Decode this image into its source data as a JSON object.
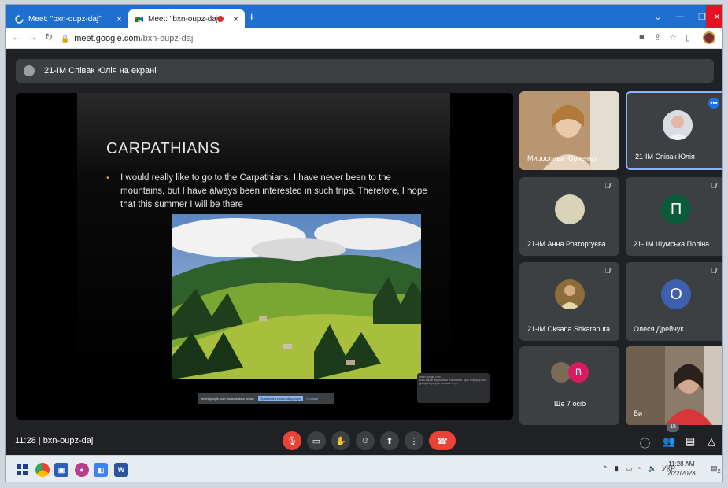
{
  "browser": {
    "tabs": [
      {
        "title": "Meet: \"bxn-oupz-daj\"",
        "active": false
      },
      {
        "title": "Meet: \"bxn-oupz-daj\"",
        "active": true
      }
    ],
    "url_host": "meet.google.com",
    "url_path": "/bxn-oupz-daj"
  },
  "meet": {
    "presenting_banner": "21-ІМ Співак Юлія на екрані",
    "slide": {
      "title": "CARPATHIANS",
      "bullet": "I would really like to go to the Carpathians. I have never been to the mountains, but I have always been interested in such trips. Therefore, I hope that this summer I will be there"
    },
    "share_bar": {
      "text": "meet.google.com показує ваш екран.",
      "primary": "Припинити спільний доступ",
      "secondary": "Сховати"
    },
    "mini_popup": {
      "host": "meet.google.com",
      "text": "Ваш екран видно всім учасникам. Щоб повернутися до відеозустрічі, натисніть тут."
    },
    "participants": [
      {
        "name": "Мирослава Юрченко"
      },
      {
        "name": "21-ІМ Співак Юлія"
      },
      {
        "name": "21-ІМ Анна Розторгуєва"
      },
      {
        "name": "21- ІМ Шумська Поліна",
        "initial": "П"
      },
      {
        "name": "21-ІМ Oksana Shkaraputa"
      },
      {
        "name": "Олеся Дрейчук",
        "initial": "О"
      },
      {
        "name": "Ще 7 осіб",
        "initial": "В"
      },
      {
        "name": "Ви"
      }
    ],
    "time": "11:28",
    "meeting_code": "bxn-oupz-daj",
    "people_count": "15"
  },
  "taskbar": {
    "lang": "УКР",
    "time": "11:28 AM",
    "date": "2/22/2023",
    "notifications": "2"
  },
  "colors": {
    "accent": "#1a73e8",
    "hangup": "#ea4335",
    "meet_bg": "#202124"
  }
}
